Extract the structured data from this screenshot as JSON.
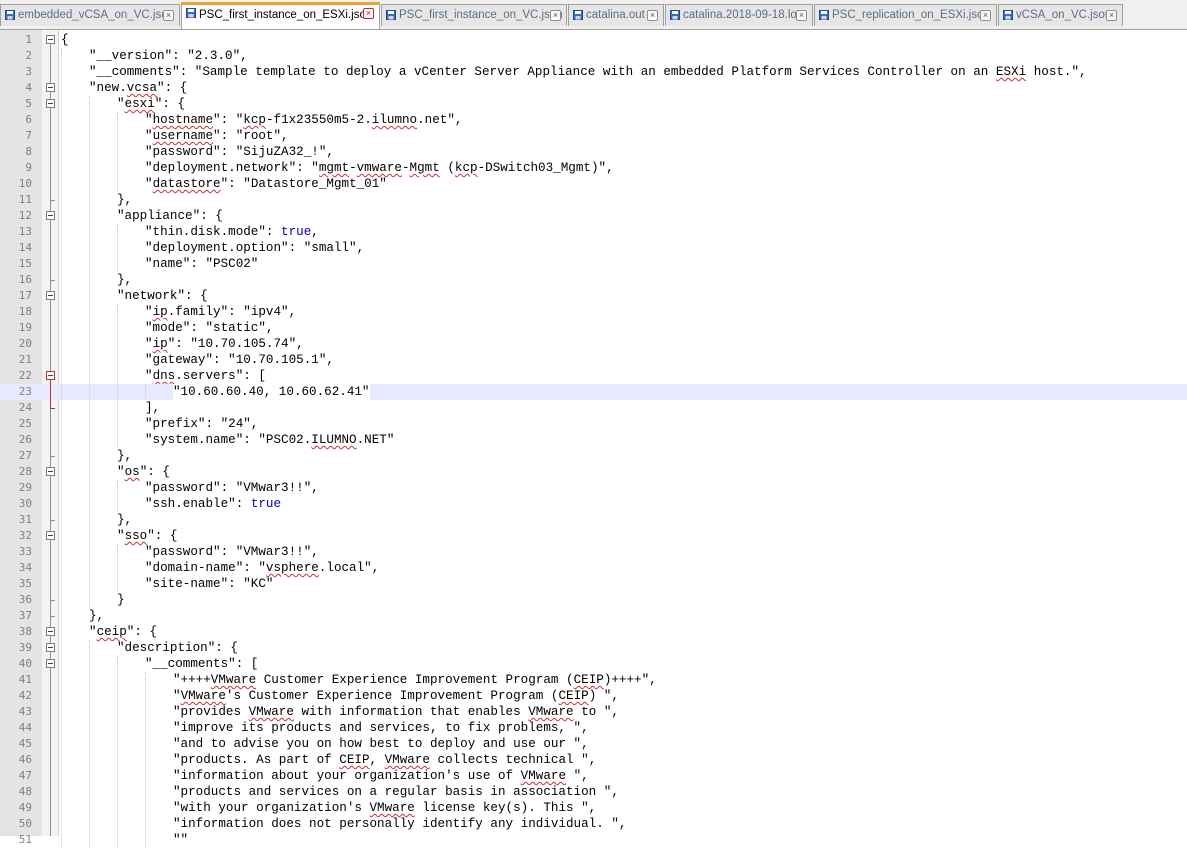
{
  "tabs": [
    {
      "label": "embedded_vCSA_on_VC.json",
      "icon": "saved-file-icon",
      "active": false
    },
    {
      "label": "PSC_first_instance_on_ESXi.json",
      "icon": "saved-file-icon",
      "active": true
    },
    {
      "label": "PSC_first_instance_on_VC.json",
      "icon": "saved-file-icon",
      "active": false
    },
    {
      "label": "catalina.out",
      "icon": "saved-file-icon",
      "active": false
    },
    {
      "label": "catalina.2018-09-18.log",
      "icon": "saved-file-icon",
      "active": false
    },
    {
      "label": "PSC_replication_on_ESXi.json",
      "icon": "saved-file-icon",
      "active": false
    },
    {
      "label": "vCSA_on_VC.json",
      "icon": "saved-file-icon",
      "active": false
    }
  ],
  "editor": {
    "current_line": 23,
    "lines": [
      {
        "n": "1",
        "indent": 0,
        "text": "{"
      },
      {
        "n": "2",
        "indent": 1,
        "text": "\"__version\": \"2.3.0\","
      },
      {
        "n": "3",
        "indent": 1,
        "text": "\"__comments\": \"Sample template to deploy a vCenter Server Appliance with an embedded Platform Services Controller on an ESXi host.\","
      },
      {
        "n": "4",
        "indent": 1,
        "text": "\"new.vcsa\": {"
      },
      {
        "n": "5",
        "indent": 2,
        "text": "\"esxi\": {"
      },
      {
        "n": "6",
        "indent": 3,
        "text": "\"hostname\": \"kcp-f1x23550m5-2.ilumno.net\","
      },
      {
        "n": "7",
        "indent": 3,
        "text": "\"username\": \"root\","
      },
      {
        "n": "8",
        "indent": 3,
        "text": "\"password\": \"SijuZA32_!\","
      },
      {
        "n": "9",
        "indent": 3,
        "text": "\"deployment.network\": \"mgmt-vmware-Mgmt (kcp-DSwitch03_Mgmt)\","
      },
      {
        "n": "10",
        "indent": 3,
        "text": "\"datastore\": \"Datastore_Mgmt_01\""
      },
      {
        "n": "11",
        "indent": 2,
        "text": "},"
      },
      {
        "n": "12",
        "indent": 2,
        "text": "\"appliance\": {"
      },
      {
        "n": "13",
        "indent": 3,
        "text": "\"thin.disk.mode\": true,"
      },
      {
        "n": "14",
        "indent": 3,
        "text": "\"deployment.option\": \"small\","
      },
      {
        "n": "15",
        "indent": 3,
        "text": "\"name\": \"PSC02\""
      },
      {
        "n": "16",
        "indent": 2,
        "text": "},"
      },
      {
        "n": "17",
        "indent": 2,
        "text": "\"network\": {"
      },
      {
        "n": "18",
        "indent": 3,
        "text": "\"ip.family\": \"ipv4\","
      },
      {
        "n": "19",
        "indent": 3,
        "text": "\"mode\": \"static\","
      },
      {
        "n": "20",
        "indent": 3,
        "text": "\"ip\": \"10.70.105.74\","
      },
      {
        "n": "21",
        "indent": 3,
        "text": "\"gateway\": \"10.70.105.1\","
      },
      {
        "n": "22",
        "indent": 3,
        "text": "\"dns.servers\": ["
      },
      {
        "n": "23",
        "indent": 4,
        "text": "\"10.60.60.40, 10.60.62.41\""
      },
      {
        "n": "24",
        "indent": 3,
        "text": "],"
      },
      {
        "n": "25",
        "indent": 3,
        "text": "\"prefix\": \"24\","
      },
      {
        "n": "26",
        "indent": 3,
        "text": "\"system.name\": \"PSC02.ILUMNO.NET\""
      },
      {
        "n": "27",
        "indent": 2,
        "text": "},"
      },
      {
        "n": "28",
        "indent": 2,
        "text": "\"os\": {"
      },
      {
        "n": "29",
        "indent": 3,
        "text": "\"password\": \"VMwar3!!\","
      },
      {
        "n": "30",
        "indent": 3,
        "text": "\"ssh.enable\": true"
      },
      {
        "n": "31",
        "indent": 2,
        "text": "},"
      },
      {
        "n": "32",
        "indent": 2,
        "text": "\"sso\": {"
      },
      {
        "n": "33",
        "indent": 3,
        "text": "\"password\": \"VMwar3!!\","
      },
      {
        "n": "34",
        "indent": 3,
        "text": "\"domain-name\": \"vsphere.local\","
      },
      {
        "n": "35",
        "indent": 3,
        "text": "\"site-name\": \"KC\""
      },
      {
        "n": "36",
        "indent": 2,
        "text": "}"
      },
      {
        "n": "37",
        "indent": 1,
        "text": "},"
      },
      {
        "n": "38",
        "indent": 1,
        "text": "\"ceip\": {"
      },
      {
        "n": "39",
        "indent": 2,
        "text": "\"description\": {"
      },
      {
        "n": "40",
        "indent": 3,
        "text": "\"__comments\": ["
      },
      {
        "n": "41",
        "indent": 4,
        "text": "\"++++VMware Customer Experience Improvement Program (CEIP)++++\","
      },
      {
        "n": "42",
        "indent": 4,
        "text": "\"VMware's Customer Experience Improvement Program (CEIP) \","
      },
      {
        "n": "43",
        "indent": 4,
        "text": "\"provides VMware with information that enables VMware to \","
      },
      {
        "n": "44",
        "indent": 4,
        "text": "\"improve its products and services, to fix problems, \","
      },
      {
        "n": "45",
        "indent": 4,
        "text": "\"and to advise you on how best to deploy and use our \","
      },
      {
        "n": "46",
        "indent": 4,
        "text": "\"products. As part of CEIP, VMware collects technical \","
      },
      {
        "n": "47",
        "indent": 4,
        "text": "\"information about your organization's use of VMware \","
      },
      {
        "n": "48",
        "indent": 4,
        "text": "\"products and services on a regular basis in association \","
      },
      {
        "n": "49",
        "indent": 4,
        "text": "\"with your organization's VMware license key(s). This \","
      },
      {
        "n": "50",
        "indent": 4,
        "text": "\"information does not personally identify any individual. \","
      },
      {
        "n": "51",
        "indent": 4,
        "text": "\"\""
      }
    ]
  },
  "folded_lines": [
    "1",
    "4",
    "5",
    "12",
    "17",
    "22",
    "28",
    "32",
    "38",
    "39",
    "40"
  ],
  "keywords": [
    "true"
  ],
  "misspelled_words": [
    "vcsa",
    "esxi",
    "hostname",
    "kcp",
    "ilumno",
    "username",
    "mgmt",
    "vmware",
    "datastore",
    "ip",
    "dns",
    "os",
    "sso",
    "vsphere",
    "ceip"
  ],
  "colors": {
    "active_tab_accent": "#f0a030",
    "current_line": "#e8e8ff",
    "keyword": "#0000c0",
    "fold_marker_active": "#c03030"
  }
}
